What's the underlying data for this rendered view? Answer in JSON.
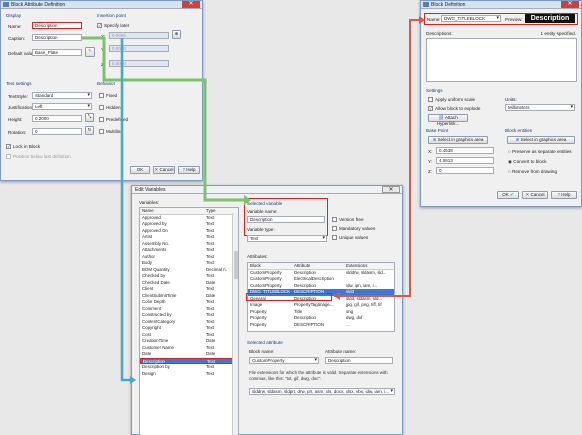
{
  "colors": {
    "highlight": "#3b78d8",
    "callout_red": "#dd2222",
    "arrow_green": "#7cc26c",
    "arrow_blue": "#4aa3d6",
    "arrow_red": "#d85a4f"
  },
  "win1": {
    "title": "Block Attribute Definition",
    "display_group": "Display",
    "insertion_group": "Insertion point",
    "name_label": "Name:",
    "name_value": "Description",
    "caption_label": "Caption:",
    "caption_value": "Description",
    "default_label": "Default value:",
    "default_value": "Base_Plate",
    "specify_later": "Specify later",
    "x_label": "X:",
    "x_value": "0.0000",
    "y_label": "Y:",
    "y_value": "0.0000",
    "z_label": "Z:",
    "z_value": "0.0000",
    "text_settings": "Text settings",
    "textstyle_label": "TextStyle:",
    "textstyle_value": "Standard",
    "justification_label": "Justification:",
    "justification_value": "Left",
    "height_label": "Height:",
    "height_value": "0.2000",
    "rotation_label": "Rotation:",
    "rotation_value": "0",
    "behavior_group": "Behavior",
    "beh_items": [
      "Fixed",
      "Hidden",
      "Predefined",
      "Multiline"
    ],
    "lock_label": "Lock in Block",
    "position_below": "Position below last definition",
    "ok": "OK",
    "cancel": "Cancel",
    "help": "Help"
  },
  "win2": {
    "title": "Edit Variables",
    "variables_label": "Variables:",
    "col_name": "Name",
    "col_type": "Type",
    "rows": [
      [
        "Approved",
        "Text"
      ],
      [
        "Approved by",
        "Text"
      ],
      [
        "Approved On",
        "Text"
      ],
      [
        "Artist",
        "Text"
      ],
      [
        "Assembly No.",
        "Text"
      ],
      [
        "Attachments",
        "Text"
      ],
      [
        "Author",
        "Text"
      ],
      [
        "Body",
        "Text"
      ],
      [
        "BOM Quantity",
        "Decimal n."
      ],
      [
        "Checked by",
        "Text"
      ],
      [
        "Checked Date",
        "Date"
      ],
      [
        "Client",
        "Text"
      ],
      [
        "ClientSubmitTime",
        "Date"
      ],
      [
        "Color Depth",
        "Text"
      ],
      [
        "Comment",
        "Text"
      ],
      [
        "Constructed by",
        "Text"
      ],
      [
        "ContentCategory",
        "Text"
      ],
      [
        "Copyright",
        "Text"
      ],
      [
        "Cost",
        "Text"
      ],
      [
        "CreationTime",
        "Date"
      ],
      [
        "Customer Name",
        "Text"
      ],
      [
        "Date",
        "Date"
      ],
      [
        "Description",
        "Text"
      ],
      [
        "Description by",
        "Text"
      ],
      [
        "Design",
        "Text"
      ]
    ],
    "selected_index": 22,
    "selected_variable": "Selected variable",
    "variable_name_label": "Variable name:",
    "variable_name_value": "Description",
    "version_free": "Version free",
    "mandatory": "Mandatory values",
    "variable_type_label": "Variable type:",
    "variable_type_value": "Text",
    "unique": "Unique values",
    "attributes_label": "Attributes:",
    "attr_cols": [
      "Block",
      "Attribute",
      "Extensions"
    ],
    "attr_rows": [
      [
        "CustomProperty",
        "Description",
        "slddrw, sldasm, sld..."
      ],
      [
        "CustomProperty",
        "ElectricalDescription",
        ""
      ],
      [
        "CustomProperty",
        "Description",
        "idw, ipn, iam, i..."
      ],
      [
        "DWG_TITLEBLOCK",
        "DESCRIPTION",
        "sldd"
      ],
      [
        "Genaral",
        "Description",
        "sldd, sldasm, sld..."
      ],
      [
        "Image",
        "PropertyTagImage...",
        "jpg, gif, png, tiff, tif"
      ],
      [
        "Property",
        "Title",
        "sng"
      ],
      [
        "Property",
        "Description",
        "dwg, dxf"
      ],
      [
        "Property",
        "DESCRIPTION",
        "..."
      ]
    ],
    "attr_selected_index": 3,
    "selected_attribute": "Selected attribute",
    "block_name_label": "Block name:",
    "attribute_name_label": "Attribute name:",
    "block_name_value": "CustomProperty",
    "attribute_name_value": "Description",
    "extensions_hint": "File extensions for which the attribute is valid. Separate extensions with commas, like this: \"txt, gif, dwg, doc\":",
    "extensions_value": "slddrw, sldasm, sldprt, drw, prt, asm, xls, docx, xlsx, vbs, idw, iam, i..."
  },
  "win3": {
    "title": "Block Definition",
    "name_label": "Name:",
    "name_value": "DWG_TITLEBLOCK",
    "preview_label": "Preview:",
    "preview_text": "Description",
    "descriptions_label": "Descriptions:",
    "entity_count": "1 entity specified.",
    "settings_group": "Settings",
    "uniform_scale": "Apply uniform scale",
    "allow_explode": "Allow block to explode",
    "attach_hyperlink": "Attach Hyperlink...",
    "units_label": "Units:",
    "units_value": "Millimeters",
    "base_point": "Base Point",
    "select_graphics": "Select in graphics area",
    "x_label": "X:",
    "x_value": "0.4538",
    "y_label": "Y:",
    "y_value": "4.0613",
    "z_label": "Z:",
    "z_value": "0",
    "block_entities": "Block entities",
    "select_graphics2": "Select in graphics area",
    "preserve": "Preserve as separate entities",
    "convert": "Convert to block",
    "remove": "Remove from drawing",
    "ok": "OK",
    "cancel": "Cancel",
    "help": "Help"
  }
}
